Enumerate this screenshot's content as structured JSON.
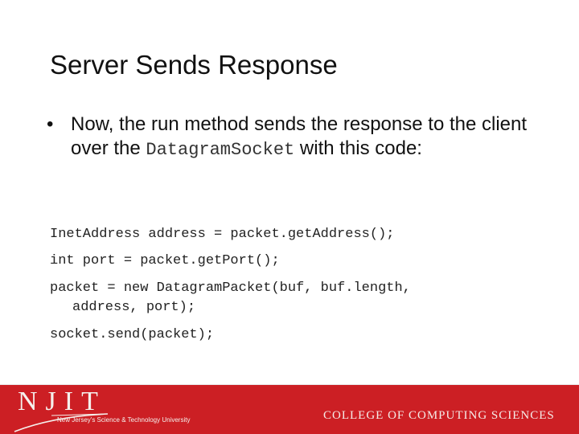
{
  "slide": {
    "title": "Server Sends Response",
    "bullet": {
      "marker": "•",
      "text_before": "Now, the run method sends the response to the client over the ",
      "code_term": "DatagramSocket",
      "text_after": " with this code:"
    },
    "code_lines": [
      "InetAddress address = packet.getAddress();",
      "int port = packet.getPort();",
      "packet = new DatagramPacket(buf, buf.length,",
      "address, port);",
      "socket.send(packet);"
    ]
  },
  "footer": {
    "logo_text": "NJIT",
    "tagline": "New Jersey's Science & Technology University",
    "college": "COLLEGE OF COMPUTING SCIENCES",
    "colors": {
      "bar": "#cc1f24",
      "text": "#f5f0ec"
    }
  }
}
